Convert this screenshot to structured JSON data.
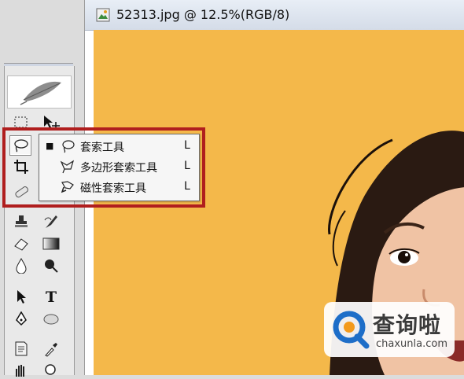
{
  "document": {
    "title": "52313.jpg @ 12.5%(RGB/8)"
  },
  "colors": {
    "canvas_background": "#f4b84a",
    "highlight_frame": "#b01e1e",
    "watermark_blue": "#1e6ec8"
  },
  "toolbox": {
    "tools": [
      {
        "name": "marquee-tool",
        "icon": "marquee-icon"
      },
      {
        "name": "move-tool",
        "icon": "move-icon"
      },
      {
        "name": "lasso-tool",
        "icon": "lasso-icon",
        "selected": true
      },
      {
        "name": "crop-tool",
        "icon": "crop-icon"
      },
      {
        "name": "healing-tool",
        "icon": "bandage-icon"
      },
      {
        "name": "stamp-tool",
        "icon": "stamp-icon"
      },
      {
        "name": "history-brush-tool",
        "icon": "history-brush-icon"
      },
      {
        "name": "eraser-tool",
        "icon": "eraser-icon"
      },
      {
        "name": "gradient-tool",
        "icon": "gradient-icon"
      },
      {
        "name": "blur-tool",
        "icon": "drop-icon"
      },
      {
        "name": "dodge-tool",
        "icon": "dodge-icon"
      },
      {
        "name": "path-selection-tool",
        "icon": "arrow-icon"
      },
      {
        "name": "type-tool",
        "icon": "type-icon",
        "glyph": "T"
      },
      {
        "name": "pen-tool",
        "icon": "pen-icon"
      },
      {
        "name": "ellipse-tool",
        "icon": "ellipse-icon"
      },
      {
        "name": "notes-tool",
        "icon": "notes-icon"
      },
      {
        "name": "eyedropper-tool",
        "icon": "eyedropper-icon"
      },
      {
        "name": "hand-tool",
        "icon": "hand-icon"
      },
      {
        "name": "zoom-tool",
        "icon": "zoom-icon"
      }
    ]
  },
  "flyout": {
    "items": [
      {
        "label": "套索工具",
        "shortcut": "L",
        "active": true,
        "icon": "lasso-icon"
      },
      {
        "label": "多边形套索工具",
        "shortcut": "L",
        "active": false,
        "icon": "polygon-lasso-icon"
      },
      {
        "label": "磁性套索工具",
        "shortcut": "L",
        "active": false,
        "icon": "magnetic-lasso-icon"
      }
    ],
    "bullet": "■"
  },
  "watermark": {
    "brand_cn": "查询啦",
    "brand_en": "chaxunla.com"
  }
}
